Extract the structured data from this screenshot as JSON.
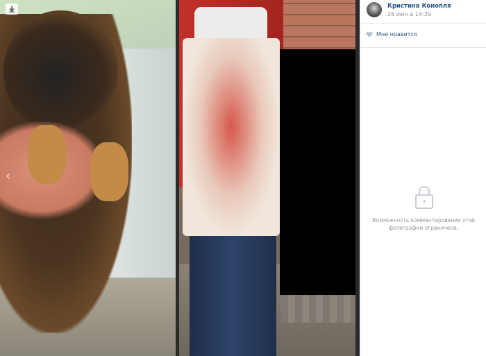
{
  "viewer": {
    "download_icon": "download-icon",
    "prev_icon": "chevron-left-icon",
    "prev_glyph": "‹"
  },
  "panel": {
    "author": {
      "name": "Кристина Конопля",
      "date": "26 июн в 14:39"
    },
    "like": {
      "icon": "heart-icon",
      "label": "Мне нравится"
    },
    "comments": {
      "icon": "lock-icon",
      "notice": "Возможность комментирования этой фотографии ограничена."
    }
  },
  "colors": {
    "link": "#2a5885",
    "muted": "#939393",
    "border": "#e7e8ec",
    "icon": "#b7c1cc"
  }
}
